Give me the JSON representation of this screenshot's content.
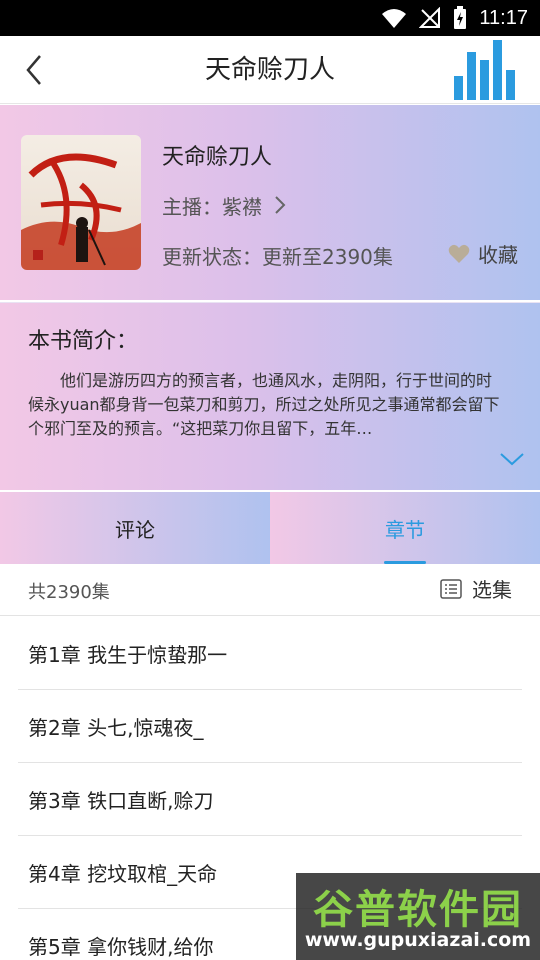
{
  "status_bar": {
    "time": "11:17",
    "icons": [
      "wifi-icon",
      "no-signal-icon",
      "battery-charging-icon"
    ]
  },
  "title_bar": {
    "title": "天命赊刀人",
    "back_icon": "chevron-left-icon",
    "player_icon": "equalizer-icon",
    "accent_color": "#2b9bdf"
  },
  "book": {
    "name": "天命赊刀人",
    "narrator": "主播：紫襟",
    "update_status": "更新状态：更新至2390集",
    "favorite_label": "收藏",
    "cover_title": "天命赊刀人"
  },
  "intro": {
    "heading": "本书简介：",
    "text": "他们是游历四方的预言者，也通风水，走阴阳，行于世间的时候永yuan都身背一包菜刀和剪刀，所过之处所见之事通常都会留下个邪门至及的预言。“这把菜刀你且留下，五年…"
  },
  "tabs": [
    {
      "label": "评论",
      "active": false
    },
    {
      "label": "章节",
      "active": true
    }
  ],
  "episodes": {
    "count_label": "共2390集",
    "select_label": "选集"
  },
  "chapters": [
    "第1章 我生于惊蛰那一",
    "第2章 头七,惊魂夜_",
    "第3章 铁口直断,赊刀",
    "第4章 挖坟取棺_天命",
    "第5章 拿你钱财,给你"
  ],
  "watermark": {
    "main": "谷普软件园",
    "sub": "www.gupuxiazai.com"
  }
}
